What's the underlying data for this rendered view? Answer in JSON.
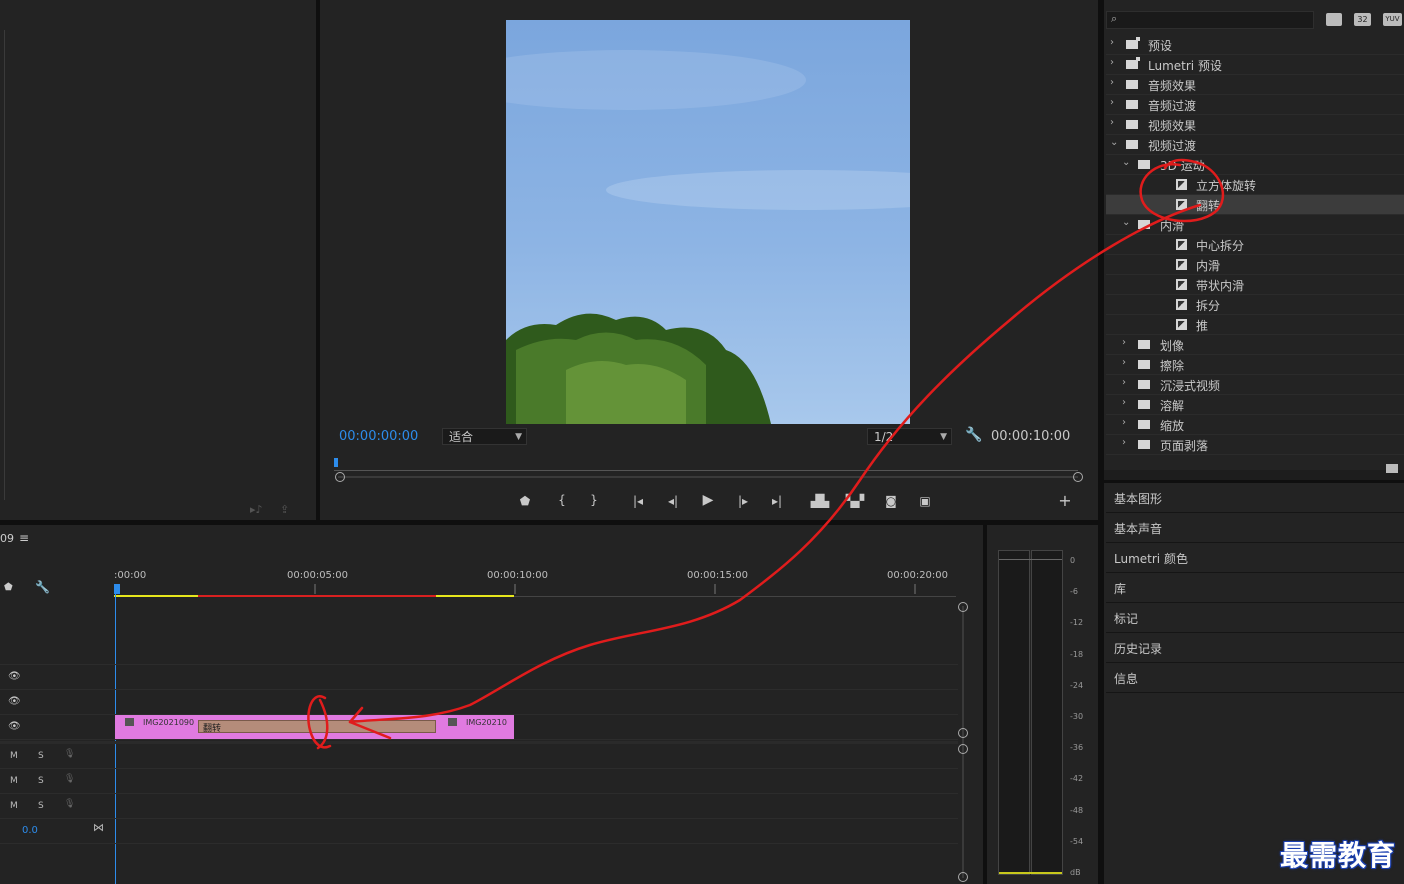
{
  "monitor": {
    "current_timecode": "00:00:00:00",
    "fit_label": "适合",
    "resolution_label": "1/2",
    "duration_timecode": "00:00:10:00"
  },
  "effects": {
    "items": [
      {
        "label": "预设",
        "level": 0,
        "expanded": false,
        "icon": "star-folder-icon"
      },
      {
        "label": "Lumetri 预设",
        "level": 0,
        "expanded": false,
        "icon": "star-folder-icon"
      },
      {
        "label": "音频效果",
        "level": 0,
        "expanded": false,
        "icon": "folder-icon"
      },
      {
        "label": "音频过渡",
        "level": 0,
        "expanded": false,
        "icon": "folder-icon"
      },
      {
        "label": "视频效果",
        "level": 0,
        "expanded": false,
        "icon": "folder-icon"
      },
      {
        "label": "视频过渡",
        "level": 0,
        "expanded": true,
        "icon": "folder-icon"
      },
      {
        "label": "3D 运动",
        "level": 1,
        "expanded": true,
        "icon": "folder-icon"
      },
      {
        "label": "立方体旋转",
        "level": 2,
        "icon": "transition-icon"
      },
      {
        "label": "翻转",
        "level": 2,
        "icon": "transition-icon",
        "selected": true
      },
      {
        "label": "内滑",
        "level": 1,
        "expanded": true,
        "icon": "folder-icon"
      },
      {
        "label": "中心拆分",
        "level": 2,
        "icon": "transition-icon"
      },
      {
        "label": "内滑",
        "level": 2,
        "icon": "transition-icon"
      },
      {
        "label": "带状内滑",
        "level": 2,
        "icon": "transition-icon"
      },
      {
        "label": "拆分",
        "level": 2,
        "icon": "transition-icon"
      },
      {
        "label": "推",
        "level": 2,
        "icon": "transition-icon"
      },
      {
        "label": "划像",
        "level": 1,
        "expanded": false,
        "icon": "folder-icon"
      },
      {
        "label": "擦除",
        "level": 1,
        "expanded": false,
        "icon": "folder-icon"
      },
      {
        "label": "沉浸式视频",
        "level": 1,
        "expanded": false,
        "icon": "folder-icon"
      },
      {
        "label": "溶解",
        "level": 1,
        "expanded": false,
        "icon": "folder-icon"
      },
      {
        "label": "缩放",
        "level": 1,
        "expanded": false,
        "icon": "folder-icon"
      },
      {
        "label": "页面剥落",
        "level": 1,
        "expanded": false,
        "icon": "folder-icon"
      }
    ],
    "badges": [
      "32",
      "YUV"
    ]
  },
  "side_panels": [
    "基本图形",
    "基本声音",
    "Lumetri 颜色",
    "库",
    "标记",
    "历史记录",
    "信息"
  ],
  "timeline": {
    "sequence_suffix": "09",
    "ruler_labels": [
      ":00:00",
      "00:00:05:00",
      "00:00:10:00",
      "00:00:15:00",
      "00:00:20:00"
    ],
    "clip_a_name": "IMG2021090",
    "clip_b_name": "IMG20210",
    "transition_label": "翻转",
    "audio_track_letters": {
      "mute": "M",
      "solo": "S"
    },
    "master_volume": "0.0"
  },
  "meter": {
    "scale": [
      "0",
      "-6",
      "-12",
      "-18",
      "-24",
      "-30",
      "-36",
      "-42",
      "-48",
      "-54",
      "dB"
    ]
  },
  "watermark": "最需教育",
  "colors": {
    "accent_blue": "#2d8ceb",
    "clip_pink": "#e07ae0",
    "transition_tan": "#b58c7a",
    "annotation_red": "#e01c1c"
  }
}
